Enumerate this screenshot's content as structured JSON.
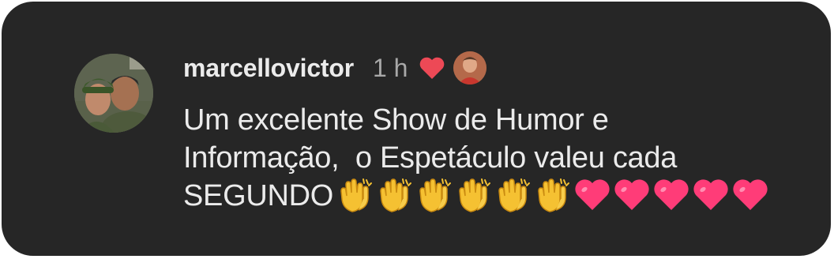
{
  "comment": {
    "username": "marcellovictor",
    "time": "1 h",
    "line1": "Um excelente Show de Humor e",
    "line2": "Informação,  o Espetáculo valeu cada",
    "line3": "SEGUNDO",
    "emoji": [
      {
        "icon": "clapping-hands-icon"
      },
      {
        "icon": "clapping-hands-icon"
      },
      {
        "icon": "clapping-hands-icon"
      },
      {
        "icon": "clapping-hands-icon"
      },
      {
        "icon": "clapping-hands-icon"
      },
      {
        "icon": "clapping-hands-icon"
      },
      {
        "icon": "pink-heart-icon"
      },
      {
        "icon": "pink-heart-icon"
      },
      {
        "icon": "pink-heart-icon"
      },
      {
        "icon": "pink-heart-icon"
      },
      {
        "icon": "pink-heart-icon"
      }
    ],
    "liked_by_author": true
  },
  "colors": {
    "card_background": "#262626",
    "text": "#ebebeb",
    "secondary_text": "#a8a8a8",
    "like_heart": "#ed4956",
    "emoji_heart": "#ff3c78",
    "clap": "#f5c132"
  }
}
